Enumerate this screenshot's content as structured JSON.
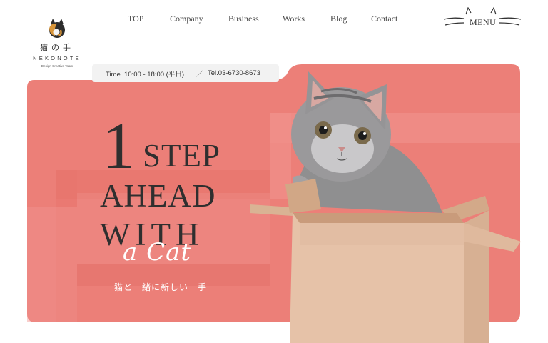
{
  "logo": {
    "name_jp": "猫の手",
    "name_en": "NEKONOTE",
    "tagline": "Design Creative Team"
  },
  "nav": [
    {
      "label": "TOP"
    },
    {
      "label": "Company"
    },
    {
      "label": "Business"
    },
    {
      "label": "Works"
    },
    {
      "label": "Blog"
    },
    {
      "label": "Contact"
    }
  ],
  "menu": {
    "label": "MENU"
  },
  "info": {
    "time": "Time. 10:00 - 18:00 (平日)",
    "separator": "／",
    "tel": "Tel.03-6730-8673"
  },
  "hero": {
    "number": "1",
    "line1": "STEP",
    "line2": "AHEAD",
    "line3": "WITH",
    "script": "a Cat",
    "subtitle": "猫と一緒に新しい一手"
  },
  "colors": {
    "hero_bg": "#ec7f78",
    "hero_light": "#f08f88",
    "hero_dark": "#e47068",
    "text": "#2f2f2f",
    "box": "#d6ab8a"
  },
  "icons": {
    "logo": "cat-logo-icon",
    "menu": "cat-ears-whiskers-icon"
  }
}
